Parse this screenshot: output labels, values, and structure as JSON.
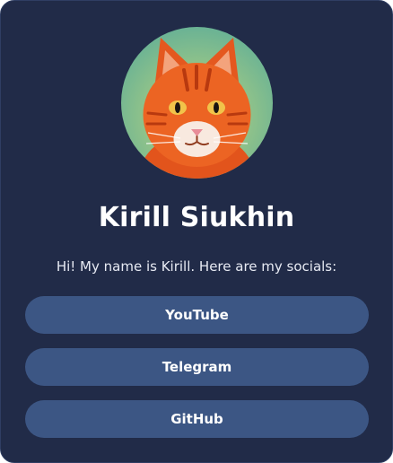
{
  "profile": {
    "name": "Kirill Siukhin",
    "bio": "Hi! My name is Kirill. Here are my socials:",
    "avatar_icon": "orange-cat-portrait"
  },
  "socials": [
    {
      "label": "YouTube"
    },
    {
      "label": "Telegram"
    },
    {
      "label": "GitHub"
    }
  ],
  "colors": {
    "card_background": "#212b48",
    "button_background": "#3c5684",
    "text": "#ffffff"
  }
}
